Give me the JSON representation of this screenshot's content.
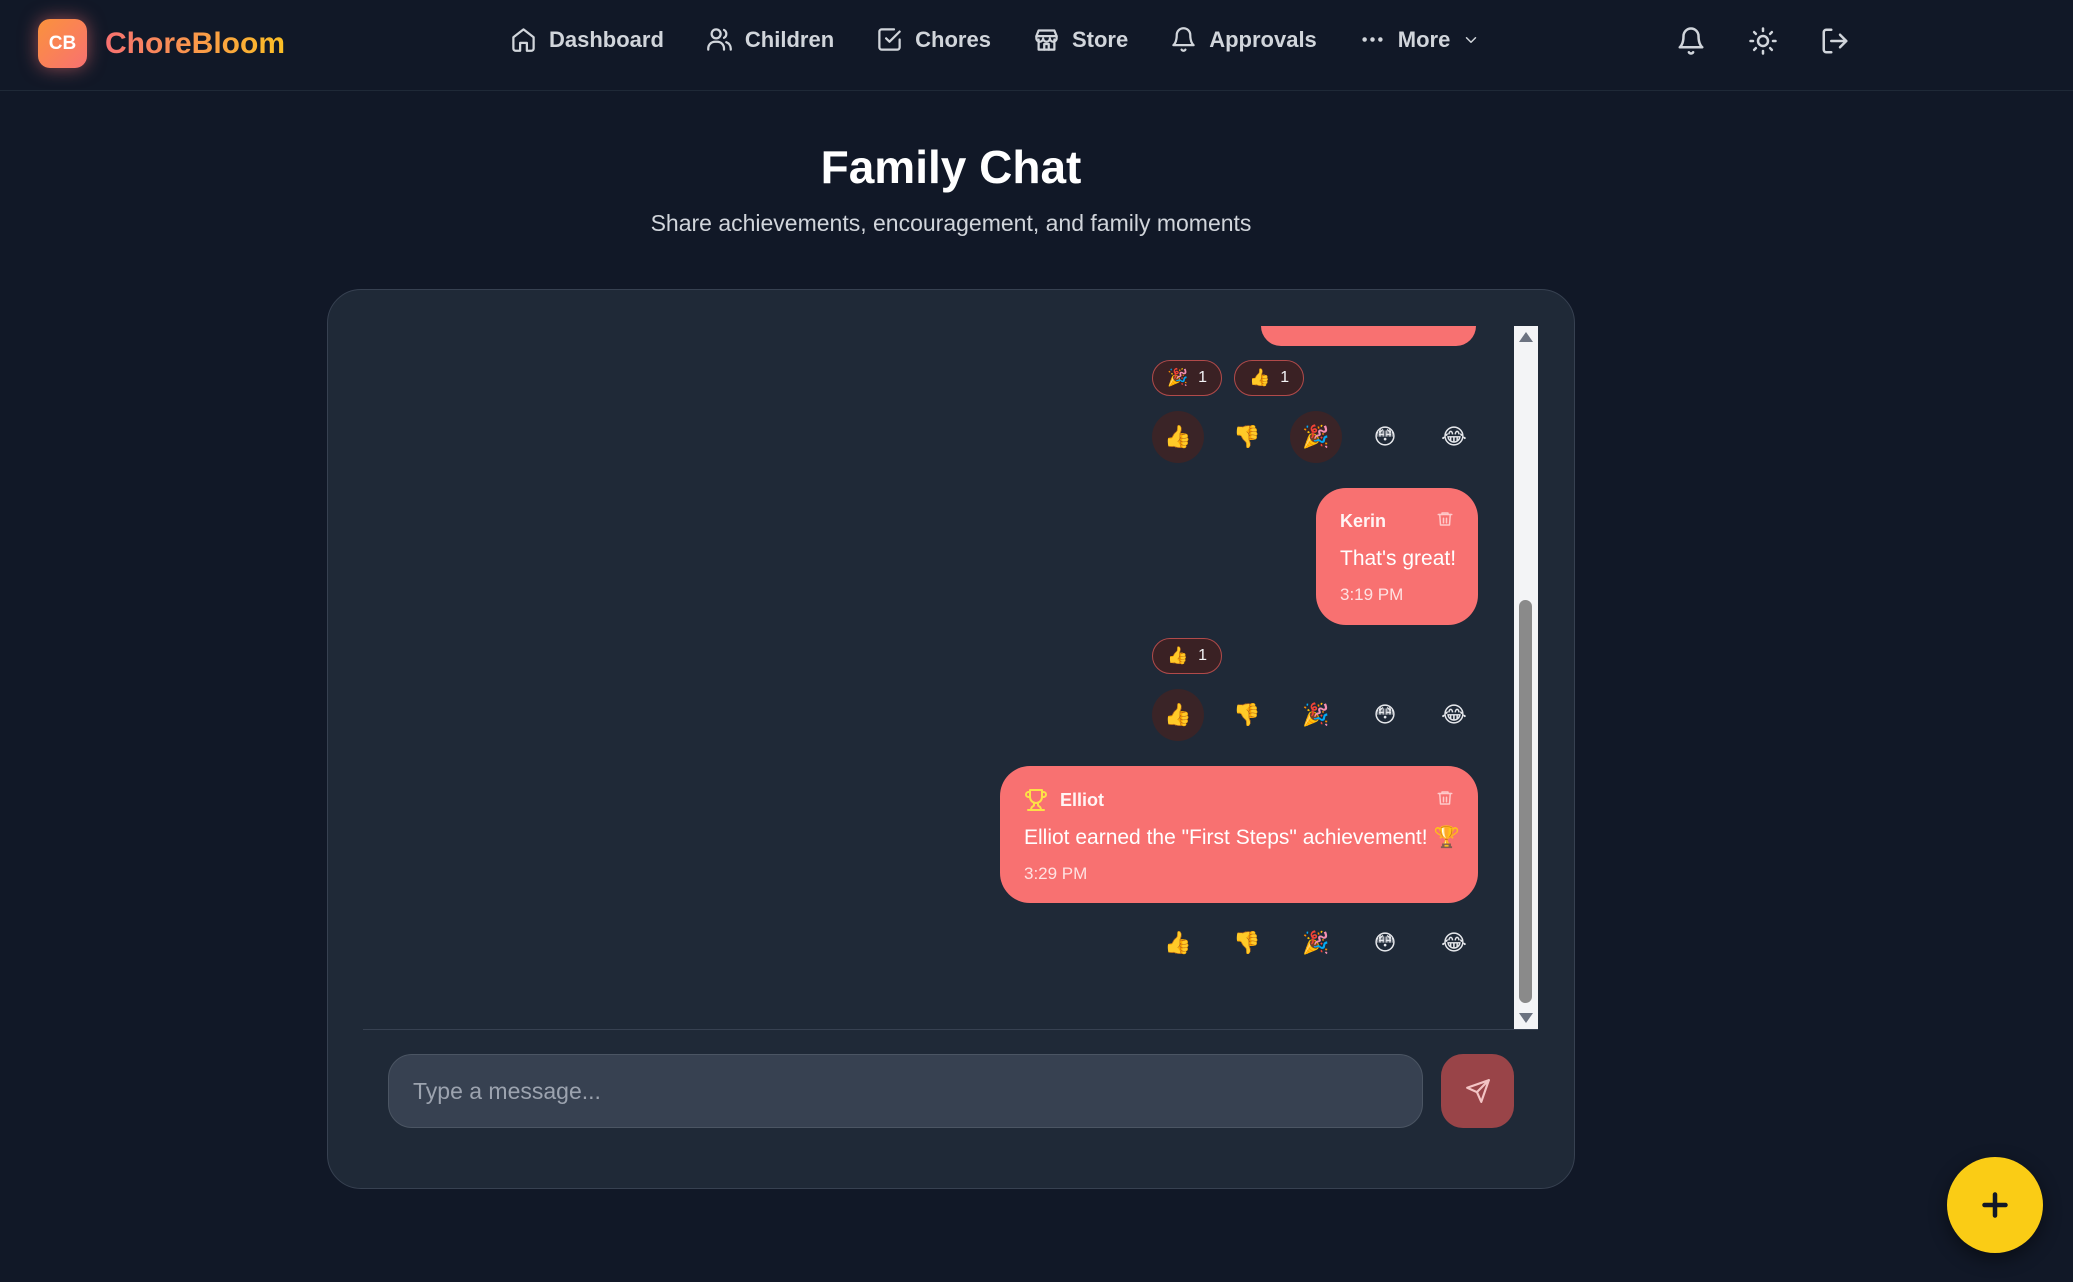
{
  "brand": {
    "logo_text": "CB",
    "name": "ChoreBloom"
  },
  "nav": {
    "items": [
      {
        "label": "Dashboard",
        "icon": "home-icon"
      },
      {
        "label": "Children",
        "icon": "users-icon"
      },
      {
        "label": "Chores",
        "icon": "check-square-icon"
      },
      {
        "label": "Store",
        "icon": "store-icon"
      },
      {
        "label": "Approvals",
        "icon": "bell-icon"
      },
      {
        "label": "More",
        "icon": "more-horizontal-icon"
      }
    ],
    "right_icons": [
      "notifications-bell-icon",
      "theme-sun-icon",
      "logout-icon"
    ]
  },
  "page": {
    "title": "Family Chat",
    "subtitle": "Share achievements, encouragement, and family moments"
  },
  "chat": {
    "top_reaction_counts": [
      {
        "emoji": "🎉",
        "count": "1"
      },
      {
        "emoji": "👍",
        "count": "1"
      }
    ],
    "reaction_options": [
      "👍",
      "👎",
      "🎉",
      "😳",
      "😂"
    ],
    "messages": [
      {
        "sender": "Kerin",
        "text": "That's great!",
        "time": "3:19 PM",
        "reaction_counts": [
          {
            "emoji": "👍",
            "count": "1"
          }
        ]
      },
      {
        "sender": "Elliot",
        "sender_icon": "trophy-icon",
        "text": "Elliot earned the \"First Steps\" achievement! 🏆",
        "time": "3:29 PM",
        "reaction_counts": []
      }
    ]
  },
  "composer": {
    "placeholder": "Type a message..."
  },
  "colors": {
    "background": "#111827",
    "panel": "#1f2937",
    "bubble": "#f87171",
    "accent_fab": "#facc15"
  }
}
